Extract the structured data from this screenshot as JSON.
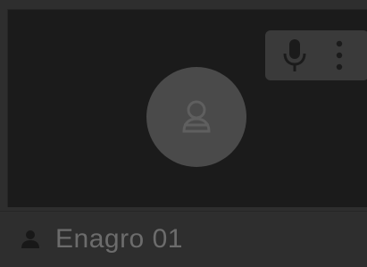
{
  "tile": {
    "participant_name": "Enagro 01",
    "icons": {
      "avatar": "user-avatar-icon",
      "mic": "microphone-icon",
      "menu": "more-vertical-icon",
      "person": "person-icon"
    }
  },
  "colors": {
    "background": "#2e2e2e",
    "video_area": "#1b1b1b",
    "avatar_circle": "#4a4a4a",
    "controls_bg": "#3a3a3a",
    "name_text": "#6c6c6c"
  }
}
